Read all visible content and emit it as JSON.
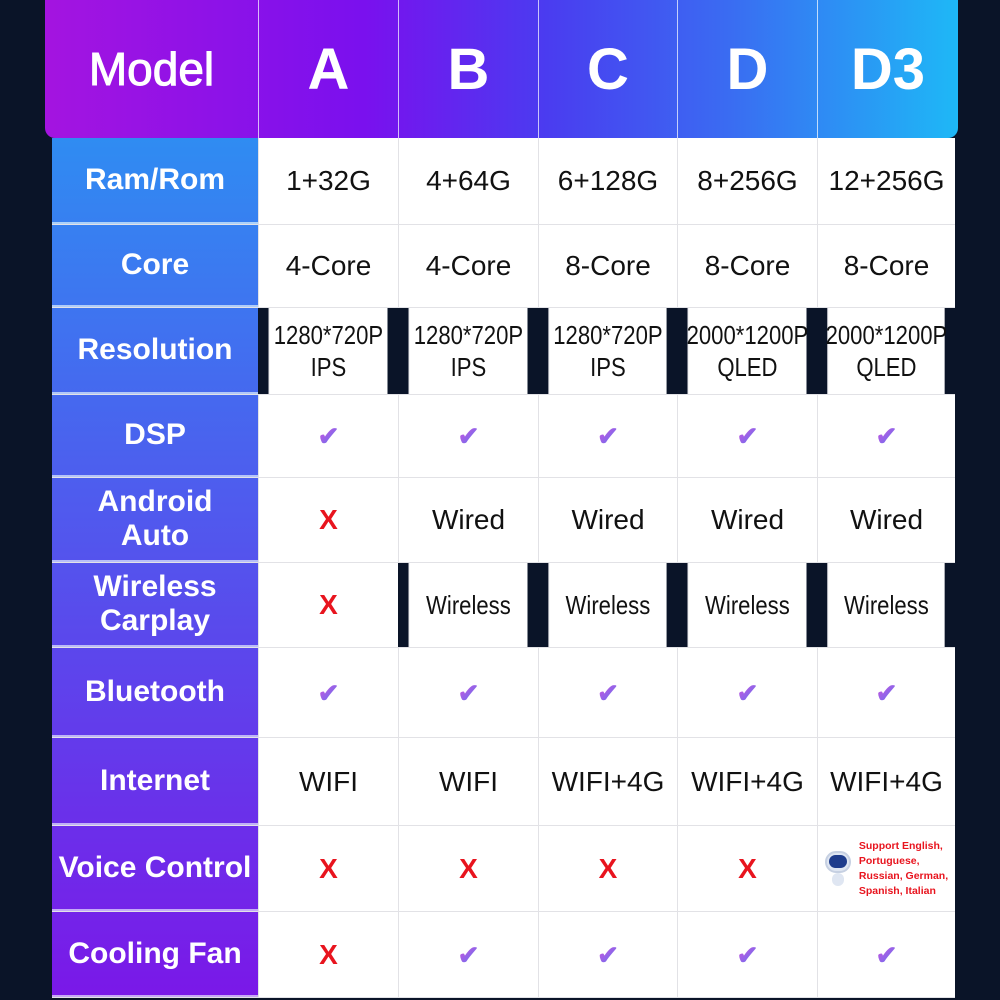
{
  "header": {
    "label": "Model",
    "models": [
      "A",
      "B",
      "C",
      "D",
      "D3"
    ]
  },
  "rows": [
    {
      "label": "Ram/Rom",
      "values": [
        "1+32G",
        "4+64G",
        "6+128G",
        "8+256G",
        "12+256G"
      ]
    },
    {
      "label": "Core",
      "values": [
        "4-Core",
        "4-Core",
        "8-Core",
        "8-Core",
        "8-Core"
      ]
    },
    {
      "label": "Resolution",
      "values": [
        "1280*720P\nIPS",
        "1280*720P\nIPS",
        "1280*720P\nIPS",
        "2000*1200P\nQLED",
        "2000*1200P\nQLED"
      ]
    },
    {
      "label": "DSP",
      "values": [
        "check",
        "check",
        "check",
        "check",
        "check"
      ]
    },
    {
      "label": "Android\nAuto",
      "values": [
        "x",
        "Wired",
        "Wired",
        "Wired",
        "Wired"
      ]
    },
    {
      "label": "Wireless\nCarplay",
      "values": [
        "x",
        "Wireless",
        "Wireless",
        "Wireless",
        "Wireless"
      ]
    },
    {
      "label": "Bluetooth",
      "values": [
        "check",
        "check",
        "check",
        "check",
        "check"
      ]
    },
    {
      "label": "Internet",
      "values": [
        "WIFI",
        "WIFI",
        "WIFI+4G",
        "WIFI+4G",
        "WIFI+4G"
      ]
    },
    {
      "label": "Voice Control",
      "values": [
        "x",
        "x",
        "x",
        "x",
        "note"
      ]
    },
    {
      "label": "Cooling Fan",
      "values": [
        "x",
        "check",
        "check",
        "check",
        "check"
      ]
    }
  ],
  "voice_note": "Support English,\nPortuguese,\nRussian, German,\nSpanish, Italian",
  "icons": {
    "check": "check-icon",
    "x": "cross-icon",
    "note": "robot-icon"
  },
  "colors": {
    "background": "#0a1428",
    "cross": "#e8141e",
    "header_start": "#a414e0",
    "header_end": "#1eb8f6",
    "label_top": "#2f8cf2",
    "label_bottom": "#7a18e8"
  }
}
